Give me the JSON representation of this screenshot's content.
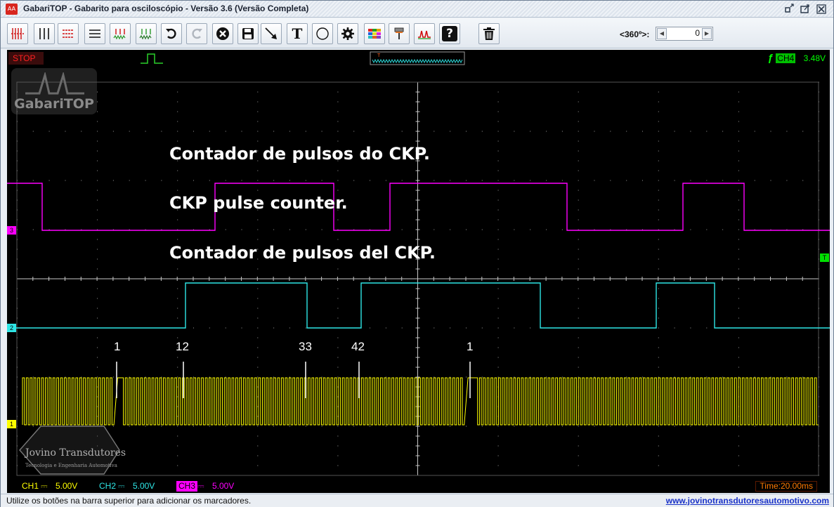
{
  "window": {
    "title": "GabariTOP - Gabarito para osciloscópio - Versão 3.6 (Versão Completa)",
    "app_icon_text": "AA"
  },
  "toolbar": {
    "buttons": [
      {
        "name": "vertical-cursors-red-icon"
      },
      {
        "name": "vertical-cursors-icon"
      },
      {
        "name": "horizontal-cursors-red-icon"
      },
      {
        "name": "horizontal-cursors-icon"
      },
      {
        "name": "waveform-markers-red-icon"
      },
      {
        "name": "waveform-markers-green-icon"
      },
      {
        "name": "undo-icon"
      },
      {
        "name": "redo-icon"
      },
      {
        "name": "close-circle-icon"
      },
      {
        "name": "save-icon"
      },
      {
        "name": "arrow-tool-icon"
      },
      {
        "name": "text-tool-icon",
        "glyph": "T"
      },
      {
        "name": "circle-tool-icon"
      },
      {
        "name": "settings-gear-icon"
      },
      {
        "name": "color-palette-icon"
      },
      {
        "name": "paint-brush-icon"
      },
      {
        "name": "waveform-peaks-icon"
      },
      {
        "name": "help-icon",
        "glyph": "?"
      },
      {
        "name": "trash-icon"
      }
    ],
    "rotation_label": "<360º>:",
    "rotation_value": "0"
  },
  "status_strip": {
    "run_state": "STOP",
    "trigger_channel": "CH4",
    "trigger_level": "3.48V"
  },
  "annotations": {
    "line_pt": "Contador de pulsos do CKP.",
    "line_en": "CKP pulse counter.",
    "line_es": "Contador de pulsos del CKP."
  },
  "markers": [
    "1",
    "12",
    "33",
    "42",
    "1"
  ],
  "watermarks": {
    "gabari": "GabariTOP",
    "jovino_name": "Jovino Transdutores",
    "jovino_sub": "Tecnologia e Engenharia Automotiva"
  },
  "channels": [
    {
      "name": "CH1",
      "scale": "5.00V",
      "color": "#ffff00"
    },
    {
      "name": "CH2",
      "scale": "5.00V",
      "color": "#00ffff"
    },
    {
      "name": "CH3",
      "scale": "5.00V",
      "color": "#ff00ff"
    }
  ],
  "channel_badges": [
    "3",
    "2",
    "1",
    "T"
  ],
  "timebase": "Time:20.00ms",
  "status": {
    "message": "Utilize os botões na barra superior para adicionar os marcadores.",
    "link": "www.jovinotransdutoresautomotivo.com"
  },
  "colors": {
    "ch1": "#ffff00",
    "ch2": "#2ee6e6",
    "ch3": "#ff00ff",
    "trigger": "#00ff00",
    "grid": "#9a9a9a",
    "stop": "#ff2020",
    "time": "#ff7a00"
  }
}
